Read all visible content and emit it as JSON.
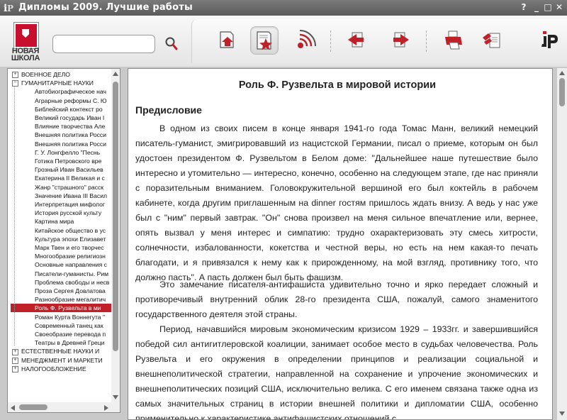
{
  "window": {
    "title": "Дипломы 2009. Лучшие работы",
    "controls": [
      "?",
      "_",
      "□",
      "✕"
    ]
  },
  "brand": {
    "line1": "НОВАЯ",
    "line2": "ШКОЛА"
  },
  "search": {
    "value": "",
    "placeholder": ""
  },
  "toolbar": {
    "tools": [
      {
        "name": "home-doc-icon"
      },
      {
        "name": "bookmark-star-icon",
        "active": true
      },
      {
        "name": "broadcast-icon"
      },
      {
        "name": "back-arrow-icon"
      },
      {
        "name": "forward-arrow-icon"
      },
      {
        "name": "print-icon"
      },
      {
        "name": "copy-doc-icon"
      },
      {
        "name": "app-logo-icon"
      }
    ]
  },
  "sidebar": {
    "categories": [
      {
        "label": "ВОЕННОЕ ДЕЛО",
        "expander": "+"
      },
      {
        "label": "ГУМАНИТАРНЫЕ НАУКИ",
        "expander": "−"
      }
    ],
    "items": [
      "Автобиографическое нач",
      "Аграрные реформы С. Ю",
      "Библейский контекст ро",
      "Великий государь Иван I",
      "Влияние творчества Але",
      "Внешняя политика Росси",
      "Внешняя политика Росси",
      "Г. У. Лонгфелло \"Песнь",
      "Готика Петровского вре",
      "Грозный Иван Васильев",
      "Екатерина II Великая и с",
      "Жанр \"страшного\" расск",
      "Значение Ивана III Васил",
      "Интерпретация мифолог",
      "История русской культу",
      "Картина мира",
      "Китайское общество в ус",
      "Культура эпохи Елизавет",
      "Марк Твен и его творчес",
      "Многообразие религиозн",
      "Основные направления с",
      "Писатели-гуманисты. Рим",
      "Проблема свободы и несв",
      "Проза Сергея Довлатова",
      "Разнообразие мегалитич",
      "Роль Ф. Рузвельта в ми",
      "Роман Курта Воннегута \"",
      "Современный танец как",
      "Своеобразие перевода п",
      "Театры в Древней Греци"
    ],
    "selected_index": 25,
    "bottom_categories": [
      {
        "label": "ЕСТЕСТВЕННЫЕ НАУКИ И",
        "expander": "+"
      },
      {
        "label": "МЕНЕДЖМЕНТ И МАРКЕТИ",
        "expander": "+"
      },
      {
        "label": "НАЛОГООБЛОЖЕНИЕ",
        "expander": "+"
      }
    ]
  },
  "document": {
    "title": "Роль Ф. Рузвельта в мировой  истории",
    "heading": "Предисловие",
    "paragraphs": [
      "В одном из своих писем в конце января 1941-го года Томас Манн, великий немецкий писатель-гуманист, эмигрировавший из нацистской Германии, писал о приеме, которым он был удостоен президентом Ф. Рузвельтом в Белом доме: \"Дальнейшее наше путешествие было интересно и утомительно — интересно, конечно, особенно на следующем этапе, где нас приняли с поразительным вниманием. Головокружительной вершиной его был коктейль в рабочем кабинете, когда другим приглашенным на dinner гостям пришлось ждать внизу. А ведь у нас уже был с \"ним\" первый завтрак. \"Он\" снова произвел на меня сильное впечатление или, вернее, опять вызвал у меня интерес и симпатию: трудно охарактеризовать эту смесь хитрости, солнечности, избалованности, кокетства и честной веры, но есть на нем какая-то печать благодати, и я привязался к нему как к прирожденному, на мой взгляд, противнику того, что должно пасть\". А пасть должен был быть фашизм.",
      "Это замечание писателя-антифашиста удивительно точно и ярко передает сложный и противоречивый внутренний облик 28-го президента США, пожалуй, самого знаменитого государственного деятеля этой страны.",
      "Период, начавшийся мировым экономическим кризисом 1929 – 1933гг. и завершившийся победой сил антигитлеровской коалиции, занимает особое место в судьбах человечества. Роль Рузвельта и его окружения в определении принципов и реализации социальной и внешнеполитической стратегии, направленной на сохранение и упрочение экономических и внешнеполитических позиций США, исключительно велика. С его именем связана также одна из самых значительных страниц в истории внешней политики и дипломатии США, особенно применительно к характеристике антифашистских отношений с"
    ]
  },
  "colors": {
    "accent": "#c02028",
    "titlebar": "#6a6a6a"
  }
}
